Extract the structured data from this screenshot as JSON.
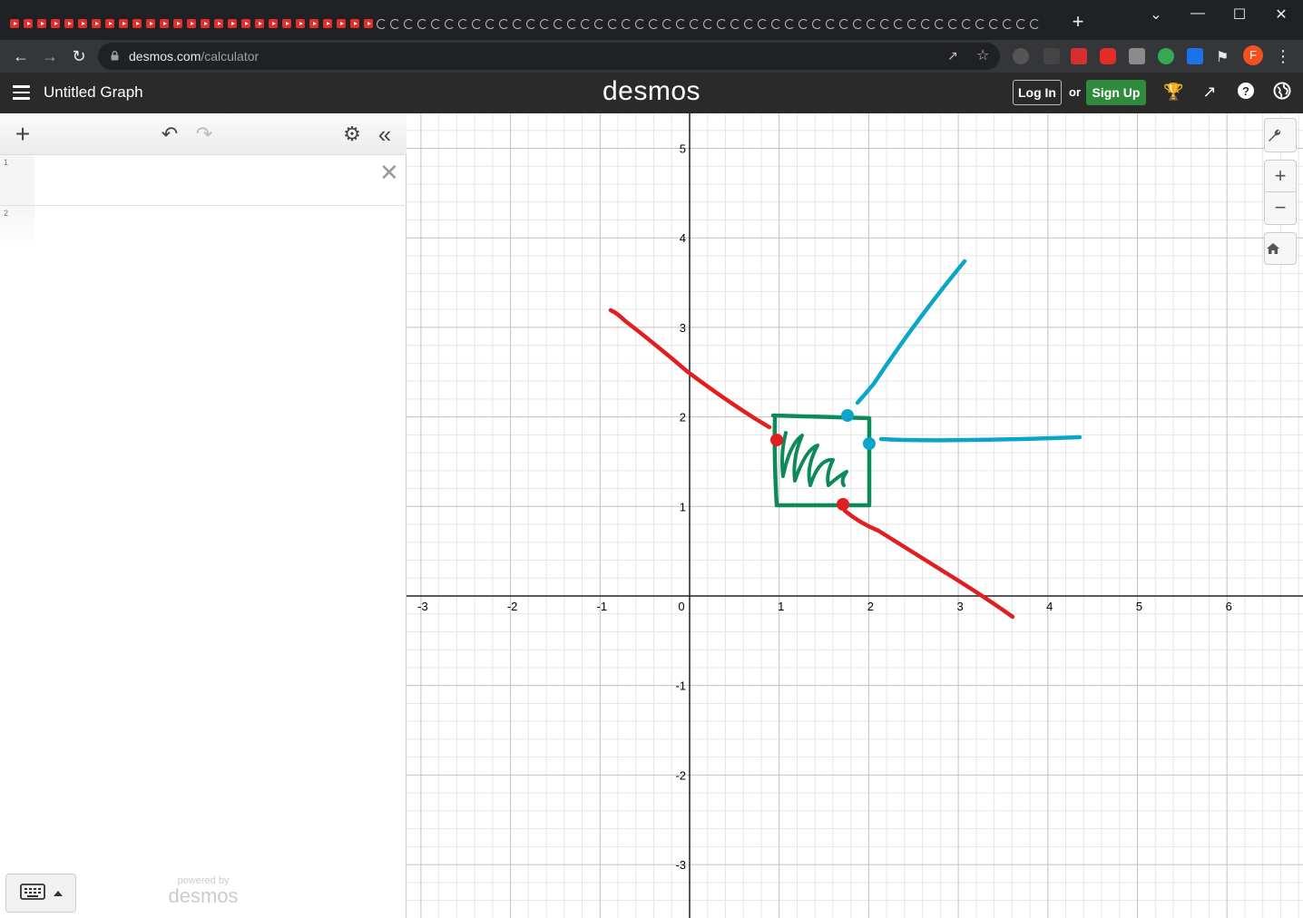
{
  "browser": {
    "tab_count_youtube": 27,
    "tab_count_desmos": 50,
    "new_tab_label": "+",
    "url_host": "desmos.com",
    "url_path": "/calculator",
    "profile_initial": "F",
    "controls": {
      "dropdown": "⌄",
      "minimize": "—",
      "maximize": "☐",
      "close": "✕"
    }
  },
  "header": {
    "menu_icon": "hamburger-icon",
    "graph_title": "Untitled Graph",
    "logo": "desmos",
    "login_label": "Log In",
    "or_label": "or",
    "signup_label": "Sign Up",
    "signup_color": "#2f8a3b"
  },
  "expressions": {
    "rows": [
      {
        "number": "1"
      },
      {
        "number": "2"
      }
    ],
    "powered_small": "powered by",
    "powered_logo": "desmos"
  },
  "graph": {
    "x_ticks": [
      "-3",
      "-2",
      "-1",
      "0",
      "1",
      "2",
      "3",
      "4",
      "5",
      "6"
    ],
    "y_ticks": [
      "5",
      "4",
      "3",
      "2",
      "1",
      "-1",
      "-2",
      "-3"
    ],
    "xlim": [
      -3.1,
      6.8
    ],
    "ylim": [
      -3.6,
      5.4
    ],
    "drawings": {
      "red": "#e02020",
      "blue": "#0aa5c9",
      "green": "#0d8a58"
    }
  }
}
